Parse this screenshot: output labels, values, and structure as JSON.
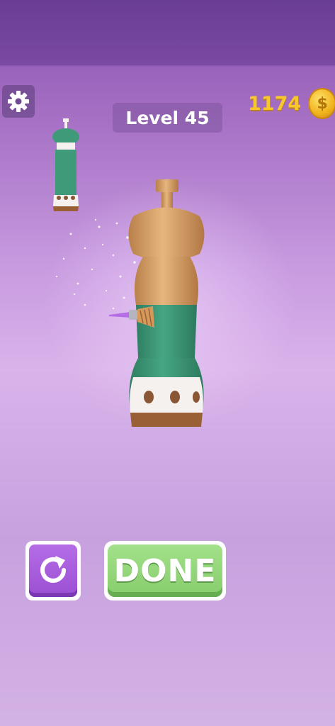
{
  "header": {
    "level_label": "Level 45",
    "coin_count": "1174",
    "coin_symbol": "$"
  },
  "buttons": {
    "done_label": "DONE"
  },
  "icons": {
    "settings": "gear-icon",
    "restart": "restart-arrow-icon",
    "coin": "gold-coin-icon"
  },
  "colors": {
    "wood": "#d9a36a",
    "green_paint": "#3f9a7a",
    "white_paint": "#f4f1ef",
    "brown_dots": "#8a5634",
    "done_green": "#8fd476",
    "restart_purple": "#a85ddc",
    "coin_gold": "#f9c72c"
  }
}
